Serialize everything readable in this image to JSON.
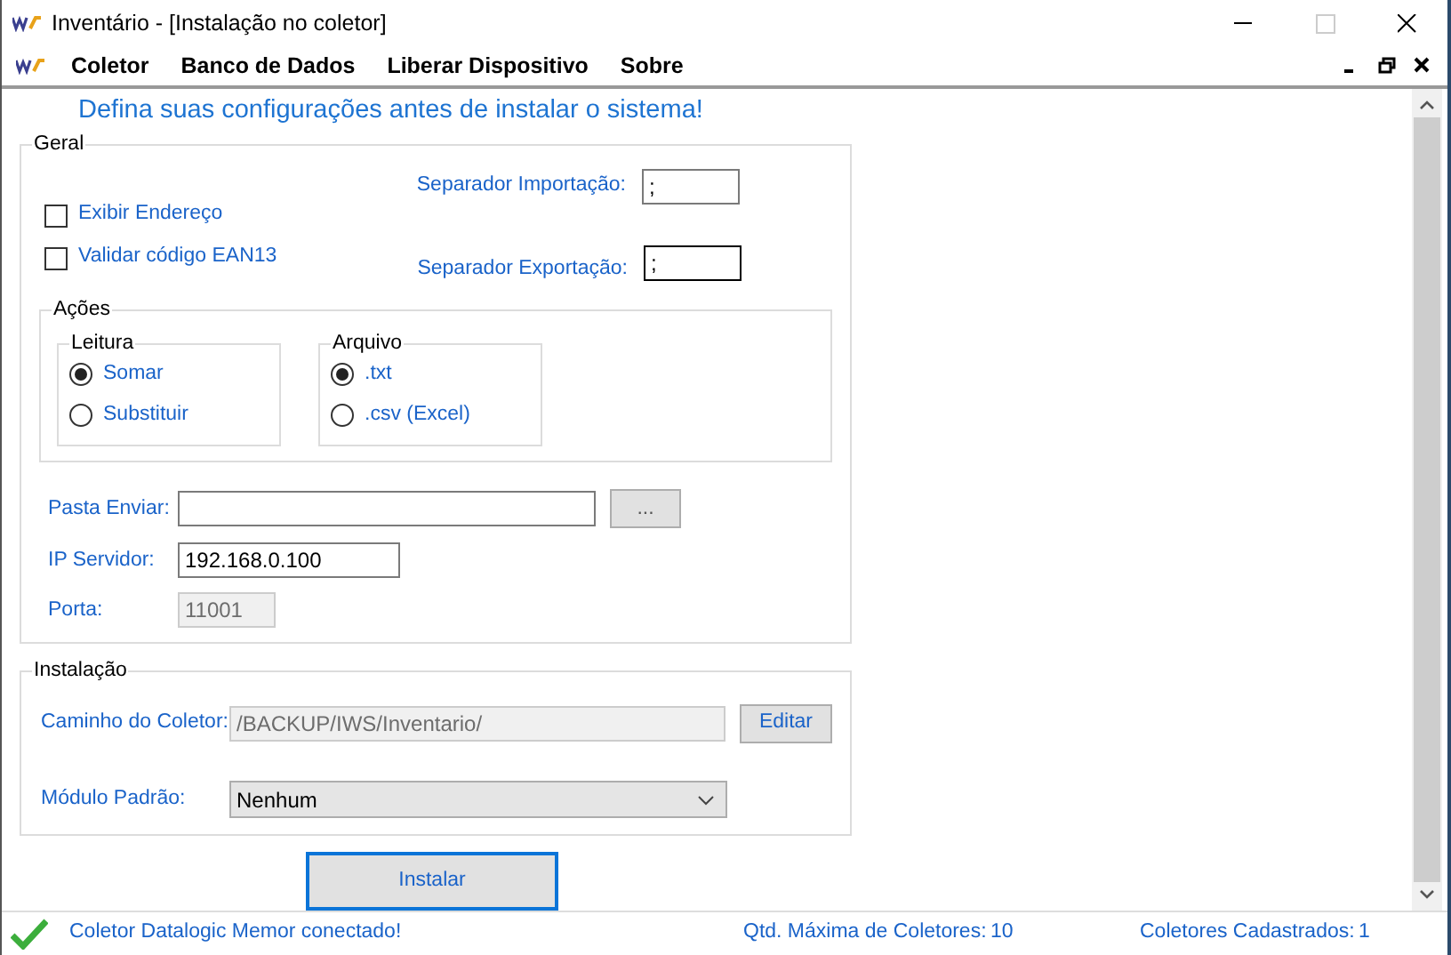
{
  "window": {
    "title": "Inventário - [Instalação no coletor]"
  },
  "menu": [
    {
      "label": "Coletor"
    },
    {
      "label": "Banco de Dados"
    },
    {
      "label": "Liberar Dispositivo"
    },
    {
      "label": "Sobre"
    }
  ],
  "heading": "Defina suas configurações antes de instalar o sistema!",
  "geral": {
    "legend": "Geral",
    "checkboxes": [
      {
        "label": "Exibir Endereço",
        "checked": false
      },
      {
        "label": "Validar código EAN13",
        "checked": false
      }
    ],
    "separators": [
      {
        "label": "Separador Importação:",
        "value": ";",
        "focused": false
      },
      {
        "label": "Separador Exportação:",
        "value": ";",
        "focused": true
      }
    ],
    "acoes": {
      "legend": "Ações",
      "groups": [
        {
          "legend": "Leitura",
          "options": [
            {
              "label": "Somar",
              "selected": true
            },
            {
              "label": "Substituir",
              "selected": false
            }
          ]
        },
        {
          "legend": "Arquivo",
          "options": [
            {
              "label": ".txt",
              "selected": true
            },
            {
              "label": ".csv (Excel)",
              "selected": false
            }
          ]
        }
      ]
    },
    "fields": [
      {
        "label": "Pasta Enviar:",
        "disabled": false,
        "button": "..."
      },
      {
        "label": "IP Servidor:",
        "value": "192.168.0.100",
        "disabled": false
      },
      {
        "label": "Porta:",
        "value": "11001",
        "disabled": true
      }
    ]
  },
  "instalacao": {
    "legend": "Instalação",
    "caminho": {
      "label": "Caminho do Coletor:",
      "value": "/BACKUP/IWS/Inventario/",
      "disabled": true,
      "button": "Editar"
    },
    "modulo": {
      "label": "Módulo Padrão:",
      "value": "Nenhum"
    }
  },
  "install_button": {
    "label": "Instalar",
    "focused": true
  },
  "status_bar": {
    "message": "Coletor Datalogic Memor conectado!",
    "items": [
      {
        "label": "Qtd. Máxima de Coletores:",
        "value": "10"
      },
      {
        "label": "Coletores Cadastrados:",
        "value": "1"
      }
    ]
  }
}
